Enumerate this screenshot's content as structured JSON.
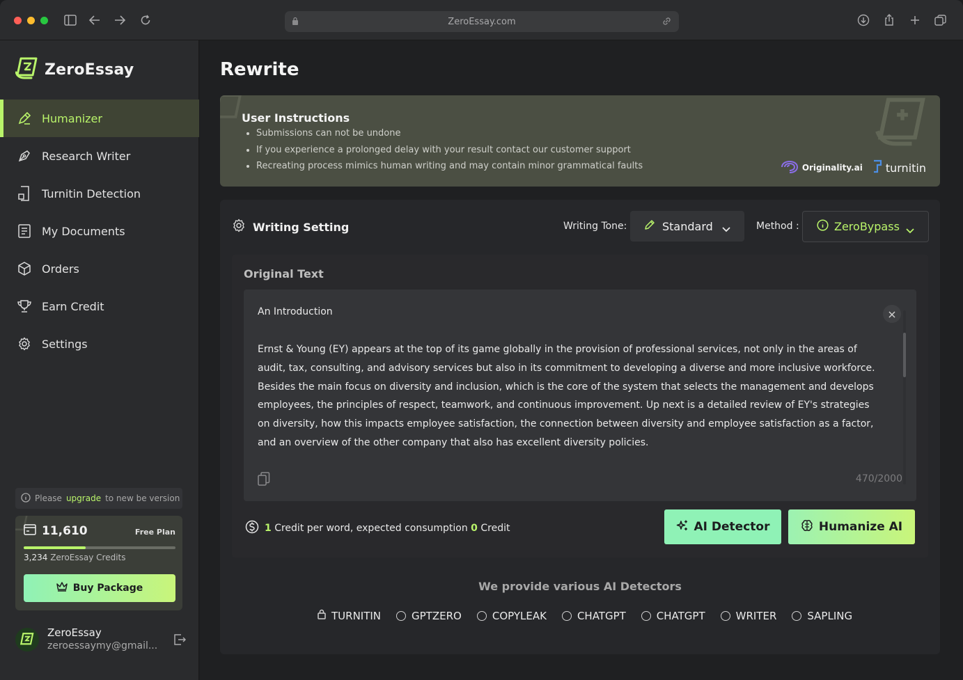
{
  "browser": {
    "url": "ZeroEssay.com",
    "colors": {
      "close": "#ff5f57",
      "minimize": "#febc2e",
      "maximize": "#28c840"
    }
  },
  "sidebar": {
    "brand": "ZeroEssay",
    "items": [
      {
        "label": "Humanizer",
        "icon": "pen-sparkle-icon",
        "active": true
      },
      {
        "label": "Research Writer",
        "icon": "pen-nib-icon",
        "active": false
      },
      {
        "label": "Turnitin Detection",
        "icon": "document-scan-icon",
        "active": false
      },
      {
        "label": "My Documents",
        "icon": "document-list-icon",
        "active": false
      },
      {
        "label": "Orders",
        "icon": "box-icon",
        "active": false
      },
      {
        "label": "Earn Credit",
        "icon": "trophy-icon",
        "active": false
      },
      {
        "label": "Settings",
        "icon": "gear-icon",
        "active": false
      }
    ],
    "upgrade": {
      "prefix": "Please",
      "link": "upgrade",
      "suffix": "to new be version"
    },
    "credits": {
      "balance": "11,610",
      "plan": "Free Plan",
      "progress": 0.41,
      "sub_amount": "3,234",
      "sub_label": "ZeroEssay Credits",
      "buy_label": "Buy Package"
    },
    "user": {
      "name": "ZeroEssay",
      "email": "zeroessaymy@gmail..."
    }
  },
  "main": {
    "title": "Rewrite",
    "instructions": {
      "title": "User Instructions",
      "items": [
        "Submissions can not be undone",
        "If you experience a prolonged delay with your result contact our customer support",
        "Recreating process mimics human writing and may contain minor grammatical faults"
      ],
      "partners": [
        "Originality.ai",
        "turnitin"
      ]
    },
    "writing_setting": {
      "title": "Writing Setting",
      "tone_label": "Writing Tone:",
      "tone_value": "Standard",
      "method_label": "Method :",
      "method_value": "ZeroBypass"
    },
    "original": {
      "label": "Original Text",
      "title": "An Introduction",
      "body": "Ernst & Young (EY) appears at the top of its game globally in the provision of professional services, not only in the areas of audit, tax, consulting, and advisory services but also in its commitment to developing a diverse and more inclusive workforce. Besides the main focus on diversity and inclusion, which is the core of the system that selects the management and develops employees, the principles of respect, teamwork, and continuous improvement. Up next is a detailed review of EY's strategies on diversity, how this impacts employee satisfaction, the connection between diversity and employee satisfaction as a factor, and an overview of the other company that also has excellent diversity policies.",
      "counter": "470/2000"
    },
    "cost": {
      "credit_num": "1",
      "text_a": "Credit per word, expected consumption",
      "zero": "0",
      "text_b": "Credit"
    },
    "actions": {
      "detector": "AI Detector",
      "humanize": "Humanize AI"
    },
    "detectors": {
      "title": "We provide various AI Detectors",
      "list": [
        "TURNITIN",
        "GPTZERO",
        "COPYLEAK",
        "CHATGPT",
        "CHATGPT",
        "WRITER",
        "SAPLING"
      ]
    },
    "accent": "#b9f46a"
  }
}
